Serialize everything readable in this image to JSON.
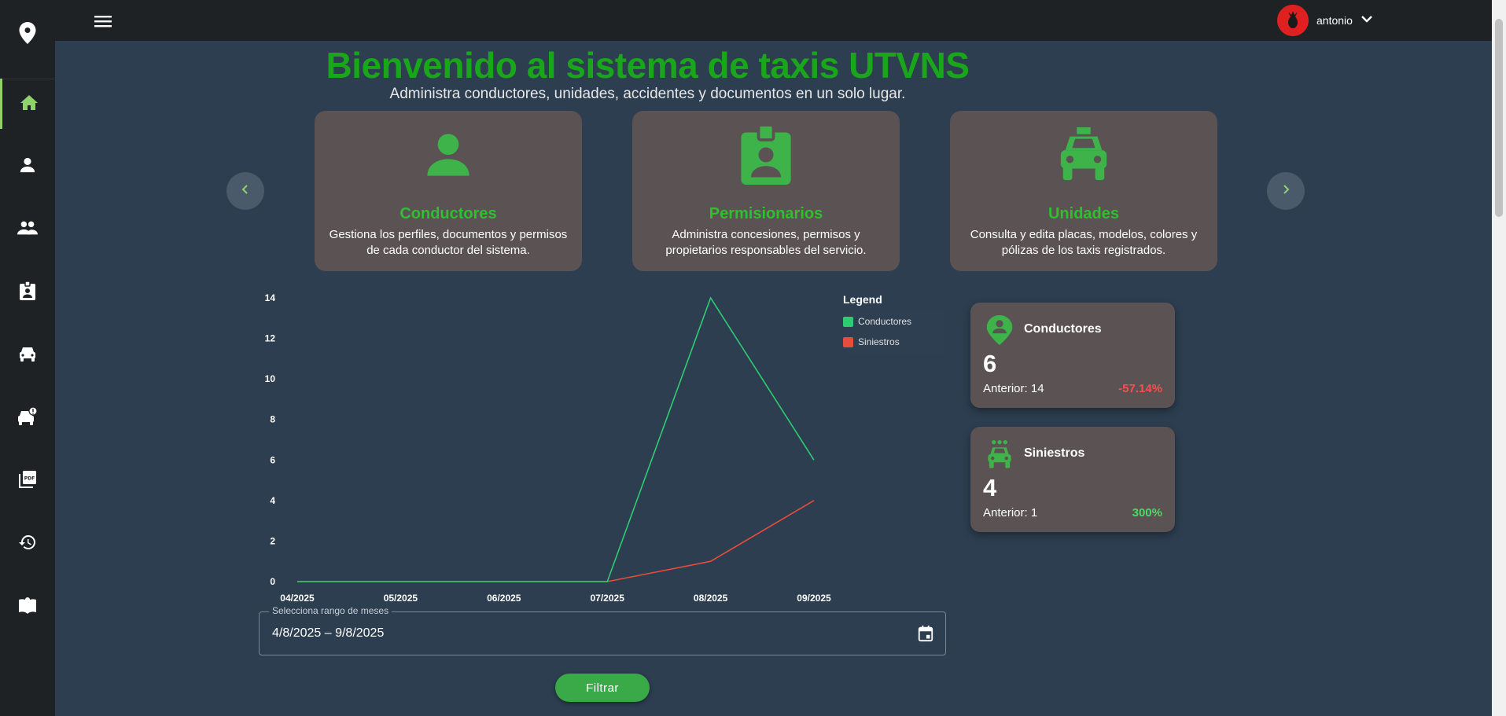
{
  "header": {
    "username": "antonio"
  },
  "sidebar": {
    "items": [
      {
        "icon": "home-icon",
        "active": true
      },
      {
        "icon": "person-icon"
      },
      {
        "icon": "group-icon"
      },
      {
        "icon": "badge-icon"
      },
      {
        "icon": "car-icon"
      },
      {
        "icon": "car-alert-icon"
      },
      {
        "icon": "pdf-icon"
      },
      {
        "icon": "history-icon"
      },
      {
        "icon": "book-icon"
      }
    ]
  },
  "hero": {
    "title": "Bienvenido al sistema de taxis UTVNS",
    "subtitle": "Administra conductores, unidades, accidentes y documentos en un solo lugar."
  },
  "cards": [
    {
      "icon": "person-icon",
      "title": "Conductores",
      "desc": "Gestiona los perfiles, documentos y permisos de cada conductor del sistema."
    },
    {
      "icon": "badge-icon",
      "title": "Permisionarios",
      "desc": "Administra concesiones, permisos y propietarios responsables del servicio."
    },
    {
      "icon": "taxi-icon",
      "title": "Unidades",
      "desc": "Consulta y edita placas, modelos, colores y pólizas de los taxis registrados."
    }
  ],
  "legend": {
    "title": "Legend",
    "items": [
      {
        "name": "Conductores",
        "color": "#2ecc71"
      },
      {
        "name": "Siniestros",
        "color": "#e74c3c"
      }
    ]
  },
  "chart_data": {
    "type": "line",
    "x": [
      "04/2025",
      "05/2025",
      "06/2025",
      "07/2025",
      "08/2025",
      "09/2025"
    ],
    "yticks": [
      "0",
      "2",
      "4",
      "6",
      "8",
      "10",
      "12",
      "14"
    ],
    "ylim": [
      0,
      14
    ],
    "grid": false,
    "legend_position": "top-right",
    "series": [
      {
        "name": "Conductores",
        "color": "#2ecc71",
        "values": [
          0,
          0,
          0,
          0,
          14,
          6
        ]
      },
      {
        "name": "Siniestros",
        "color": "#e74c3c",
        "values": [
          0,
          0,
          0,
          0,
          1,
          4
        ]
      }
    ]
  },
  "stats": [
    {
      "icon": "person-pin-icon",
      "name": "Conductores",
      "value": "6",
      "previous": "Anterior: 14",
      "change": "-57.14%",
      "change_color": "#ff4d4d"
    },
    {
      "icon": "car-wash-icon",
      "name": "Siniestros",
      "value": "4",
      "previous": "Anterior: 1",
      "change": "300%",
      "change_color": "#4cd964"
    }
  ],
  "filter": {
    "label": "Selecciona rango de meses",
    "value": "4/8/2025  – 9/8/2025",
    "button": "Filtrar"
  }
}
